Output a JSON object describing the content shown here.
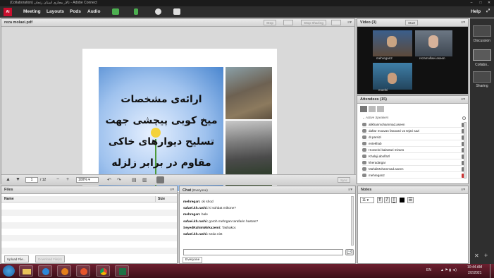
{
  "window": {
    "title": "(Collaboration) تالار مجازی استان زنجان - Adobe Connect"
  },
  "menu": {
    "items": [
      "Meeting",
      "Layouts",
      "Pods",
      "Audio"
    ],
    "help": "Help"
  },
  "share": {
    "title": "reza molaei.pdf",
    "stop_label": "Stop",
    "stop_sharing_label": "Stop Sharing",
    "slide_lines": [
      "ارائه‌ی مشخصات",
      "میخ کوبی پیچشی جهت",
      "تسلیح دیوارهای خاکی",
      "مقاوم در برابر زلزله"
    ],
    "page": "1",
    "page_total": "/ 12",
    "zoom": "100%",
    "sync_label": "Sync"
  },
  "video": {
    "title": "Video",
    "count": "(3)",
    "start_label": "Start",
    "participants": [
      "mehregan2",
      "rezamollaei.aseen",
      "moelni"
    ]
  },
  "attendees": {
    "title": "Attendees",
    "count": "(15)",
    "section": "Active Speakers",
    "list": [
      "alikhanmohammad.aseen",
      "daftar moavan fanavari va tejari sazi",
      "dr.parsizi",
      "entekhab",
      "Hosseini kalantari mirans",
      "Khalaji.abolfazl",
      "kheradargar",
      "MahdiMohammad.aseen",
      "mehregan2"
    ]
  },
  "files": {
    "title": "Files",
    "col_name": "Name",
    "col_size": "Size",
    "upload_label": "Upload File...",
    "download_label": "Download File(s)"
  },
  "chat": {
    "title": "Chat",
    "scope": "(Everyone)",
    "messages": [
      {
        "user": "mehregan:",
        "text": "ok shod"
      },
      {
        "user": "safaei.kh.rashi:",
        "text": "ki sohbat mikone?"
      },
      {
        "user": "mehregan:",
        "text": "bale"
      },
      {
        "user": "safaei.kh.rashi:",
        "text": "goroh mehrgan tarafarin hastan?"
      },
      {
        "user": "SeyedRahimMirkazemi:",
        "text": "Tashakor."
      },
      {
        "user": "safaei.kh.rashi:",
        "text": "seda nist"
      }
    ],
    "tab": "Everyone"
  },
  "notes": {
    "title": "Notes",
    "font_size": "11"
  },
  "rail": {
    "items": [
      "Discussion",
      "Collabo..",
      "Sharing"
    ]
  },
  "taskbar": {
    "lang": "EN",
    "time": "10:44 AM",
    "date": "2/2/2021"
  }
}
